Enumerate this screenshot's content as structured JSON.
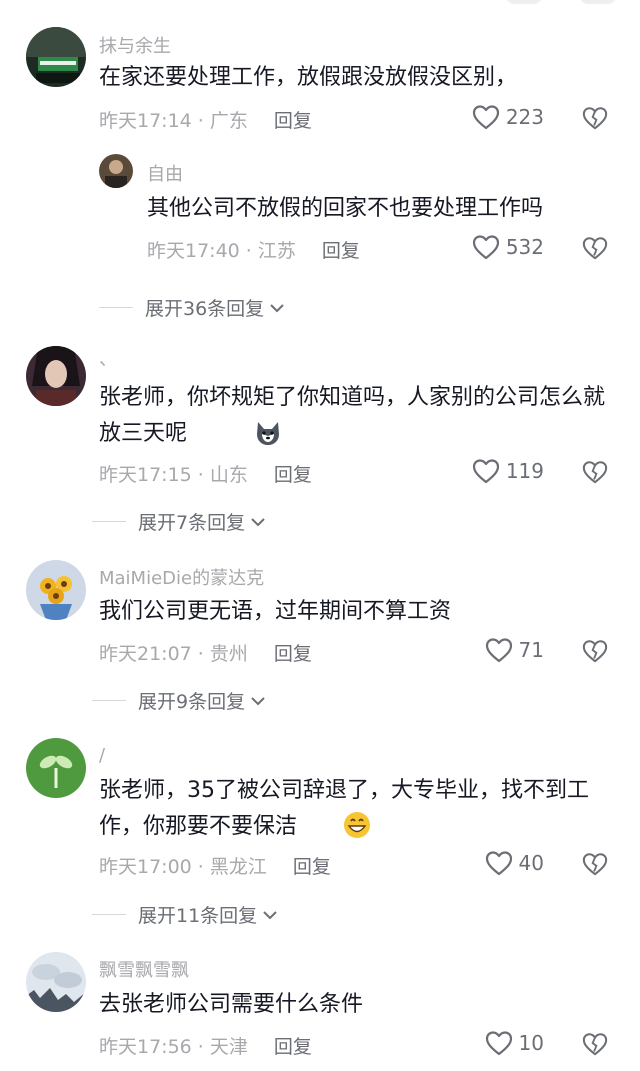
{
  "comments": [
    {
      "username": "抹与余生",
      "text": "在家还要处理工作，放假跟没放假没区别，",
      "time": "昨天17:14",
      "location": "广东",
      "reply_label": "回复",
      "likes": "223",
      "replies": [
        {
          "username": "自由",
          "text": "其他公司不放假的回家不也要处理工作吗",
          "time": "昨天17:40",
          "location": "江苏",
          "reply_label": "回复",
          "likes": "532"
        }
      ],
      "expand_label": "展开36条回复"
    },
    {
      "username": "、",
      "text": "张老师，你坏规矩了你知道吗，人家别的公司怎么就放三天呢",
      "time": "昨天17:15",
      "location": "山东",
      "reply_label": "回复",
      "likes": "119",
      "expand_label": "展开7条回复"
    },
    {
      "username": "MaiMieDie的蒙达克",
      "text": "我们公司更无语，过年期间不算工资",
      "time": "昨天21:07",
      "location": "贵州",
      "reply_label": "回复",
      "likes": "71",
      "expand_label": "展开9条回复"
    },
    {
      "username": "/",
      "text": "张老师，35了被公司辞退了，大专毕业，找不到工作，你那要不要保洁",
      "time": "昨天17:00",
      "location": "黑龙江",
      "reply_label": "回复",
      "likes": "40",
      "expand_label": "展开11条回复"
    },
    {
      "username": "飘雪飘雪飘",
      "text": "去张老师公司需要什么条件",
      "time": "昨天17:56",
      "location": "天津",
      "reply_label": "回复",
      "likes": "10"
    }
  ],
  "icons": {
    "like": "heart-outline-icon",
    "dislike": "broken-heart-icon",
    "expand": "chevron-down-icon"
  },
  "colors": {
    "text": "#161823",
    "meta": "#a8a8ad",
    "secondary": "#6b6e75"
  }
}
